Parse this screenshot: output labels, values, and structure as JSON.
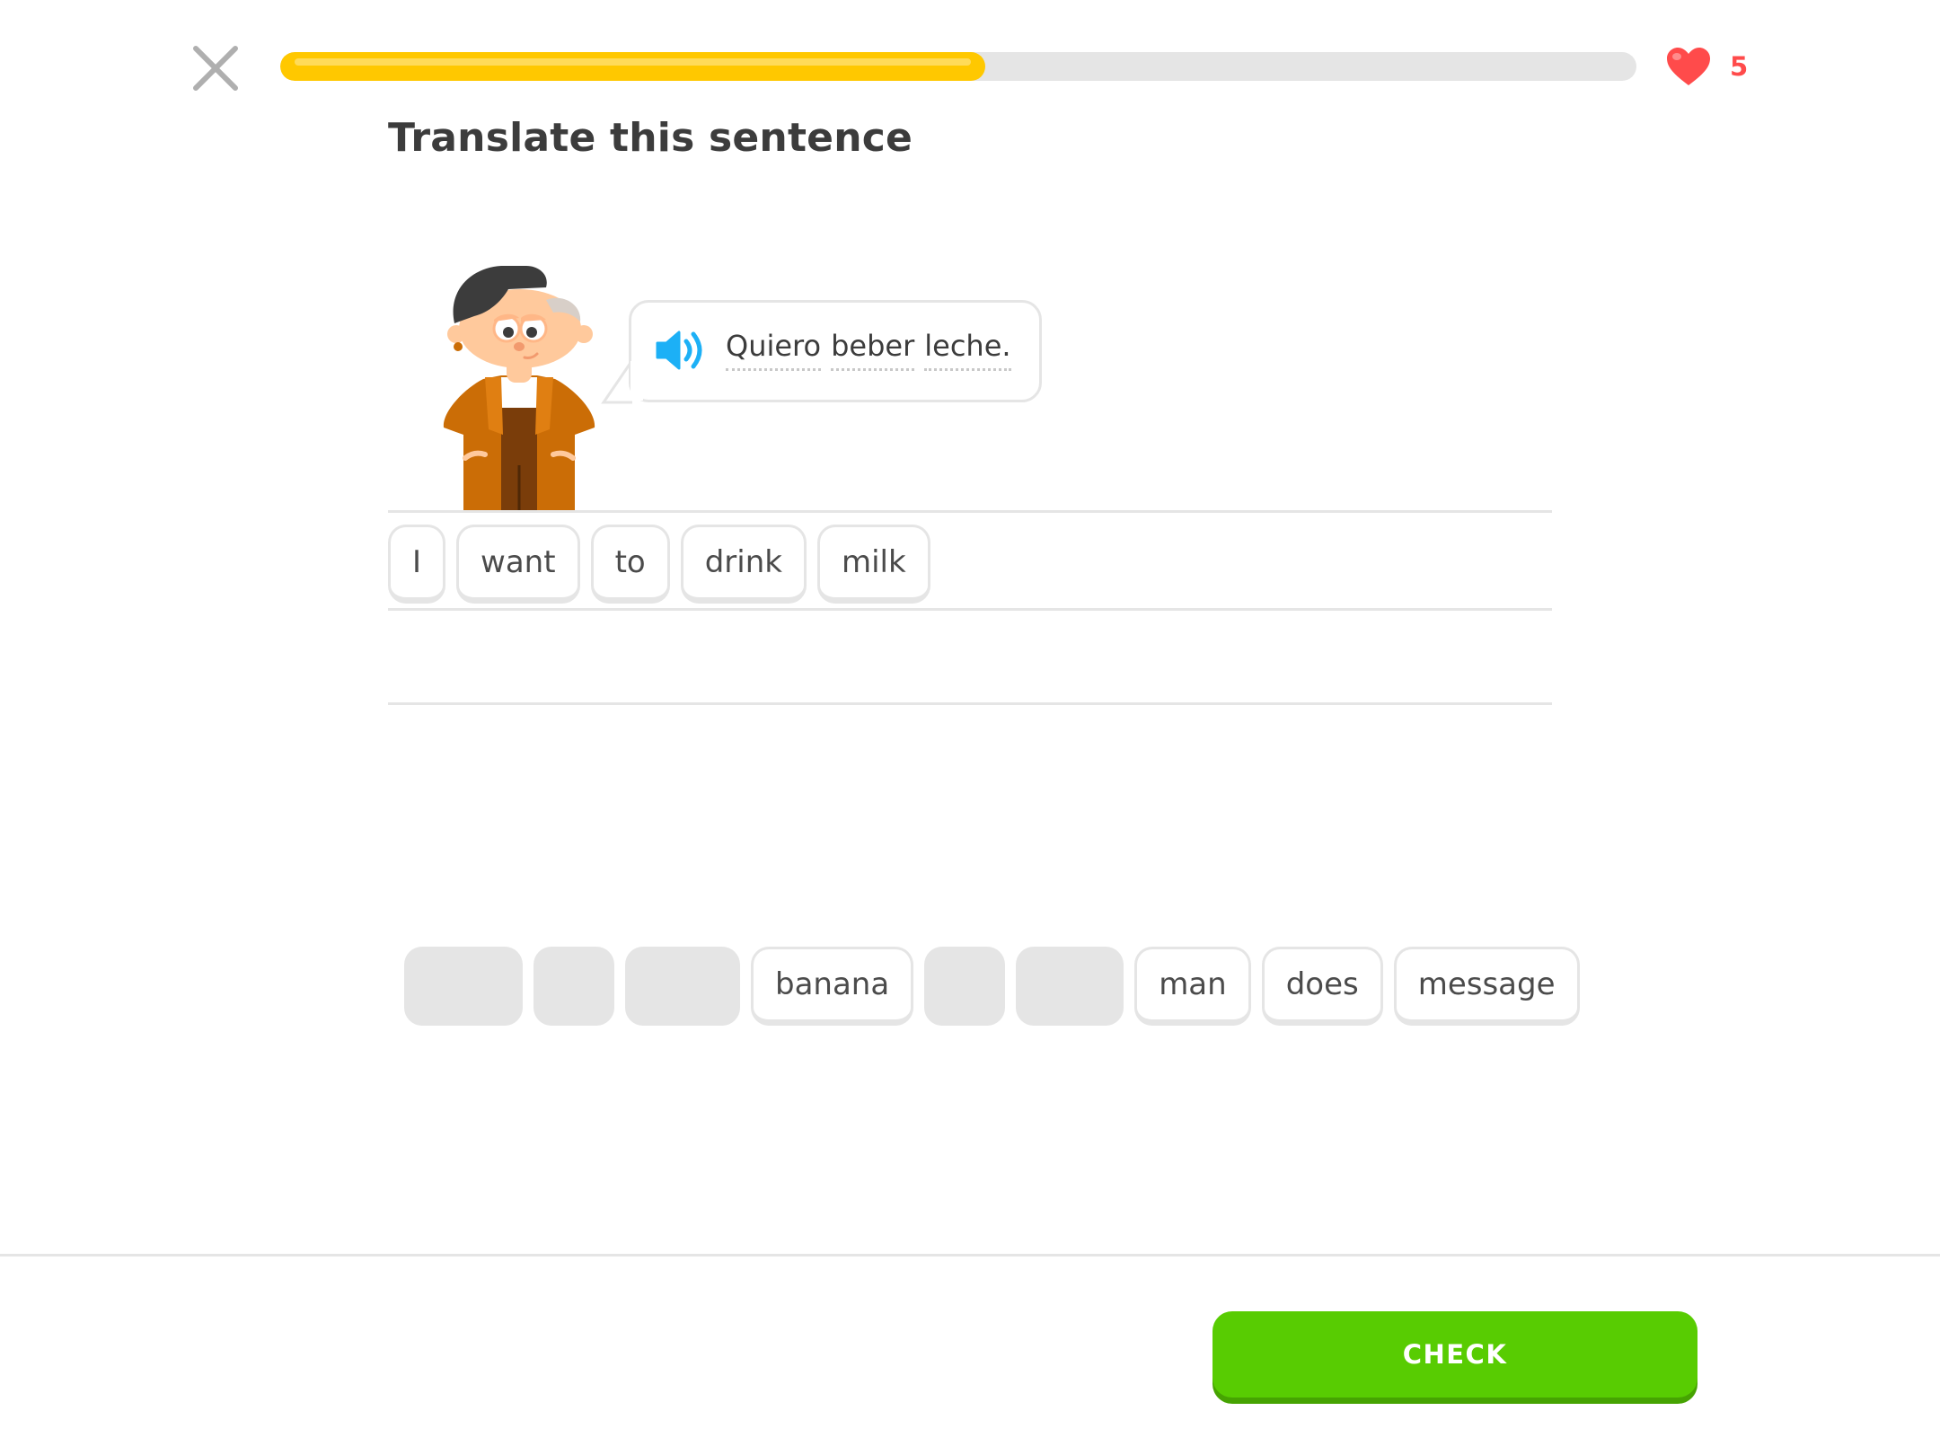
{
  "progress": {
    "value_fraction": 0.52
  },
  "hearts": {
    "count": "5"
  },
  "challenge": {
    "title": "Translate this sentence"
  },
  "prompt": {
    "words": [
      "Quiero",
      "beber",
      "leche."
    ]
  },
  "answer": {
    "tiles": [
      "I",
      "want",
      "to",
      "drink",
      "milk"
    ]
  },
  "word_bank": [
    {
      "label": "",
      "used": true
    },
    {
      "label": "",
      "used": true
    },
    {
      "label": "",
      "used": true
    },
    {
      "label": "banana",
      "used": false
    },
    {
      "label": "",
      "used": true
    },
    {
      "label": "",
      "used": true
    },
    {
      "label": "man",
      "used": false
    },
    {
      "label": "does",
      "used": false
    },
    {
      "label": "message",
      "used": false
    }
  ],
  "footer": {
    "check_label": "CHECK"
  },
  "colors": {
    "progress": "#ffc800",
    "heart": "#ff4b4b",
    "speaker": "#1cb0f6",
    "check": "#58cc02",
    "border": "#e5e5e5"
  }
}
